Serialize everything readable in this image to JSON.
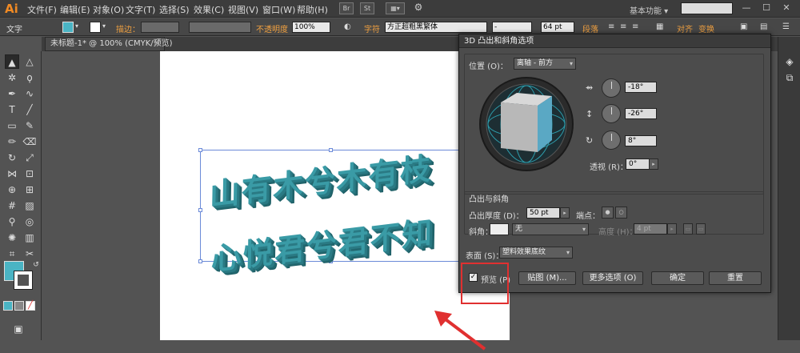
{
  "app": {
    "logo": "Ai"
  },
  "menu": [
    "文件(F)",
    "编辑(E)",
    "对象(O)",
    "文字(T)",
    "选择(S)",
    "效果(C)",
    "视图(V)",
    "窗口(W)",
    "帮助(H)"
  ],
  "menu_buttons": [
    "Br",
    "St"
  ],
  "workspace_label": "基本功能 ▾",
  "window_controls": [
    "—",
    "☐",
    "✕"
  ],
  "control_bar": {
    "tool_label": "文字",
    "stroke_label": "描边：",
    "opacity_label": "不透明度",
    "opacity_value": "100%",
    "char_label": "字符",
    "font_name": "方正超粗黑繁体",
    "font_style": "-",
    "font_size": "64 pt",
    "paragraph_label": "段落",
    "align_label": "对齐",
    "transform_label": "变换"
  },
  "doc_tab": {
    "label": "未标题-1* @ 100% (CMYK/预览)",
    "close": "×"
  },
  "artwork": {
    "line1": "山有木兮木有枝",
    "line2": "心悦君兮君不知"
  },
  "dialog": {
    "title": "3D 凸出和斜角选项",
    "position_label": "位置 (O)：",
    "position_value": "离轴 - 前方",
    "rot_x": "-18°",
    "rot_y": "-26°",
    "rot_z": "8°",
    "perspective_label": "透视 (R)：",
    "perspective_value": "0°",
    "extrude_section": "凸出与斜角",
    "depth_label": "凸出厚度 (D)：",
    "depth_value": "50 pt",
    "cap_label": "端点：",
    "bevel_label": "斜角：",
    "bevel_value": "无",
    "height_label": "高度 (H)：",
    "height_value": "4 pt",
    "surface_label": "表面 (S)：",
    "surface_value": "塑料效果底纹",
    "preview_label": "预览 (P)",
    "preview_checked": "✓",
    "buttons": {
      "map": "贴图 (M)...",
      "more": "更多选项 (O)",
      "ok": "确定",
      "cancel": "重置"
    }
  },
  "colors": {
    "fill": "#4ab4c4",
    "text3d": "#3a9ba6",
    "accent": "#f0a040",
    "annotation": "#e03030"
  }
}
